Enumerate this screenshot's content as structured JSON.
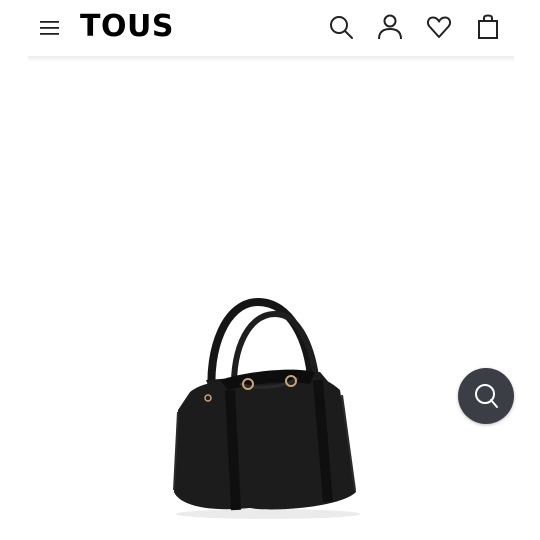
{
  "header": {
    "brand": "TOUS",
    "icons": [
      "menu-icon",
      "search-icon",
      "account-icon",
      "heart-icon",
      "bag-icon"
    ]
  },
  "product": {
    "image": "black-handbag"
  },
  "chat": {
    "icon": "chat-search-icon",
    "color": "#3b3f45"
  }
}
